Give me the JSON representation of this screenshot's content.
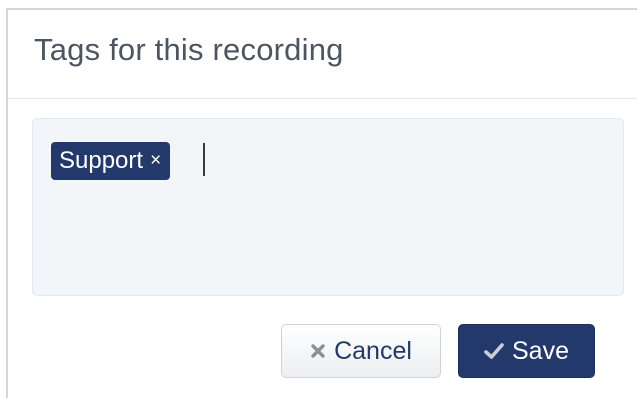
{
  "dialog": {
    "title": "Tags for this recording"
  },
  "tags": {
    "items": [
      {
        "label": "Support",
        "remove_glyph": "×"
      }
    ],
    "input_value": "",
    "input_placeholder": ""
  },
  "actions": {
    "cancel_label": "Cancel",
    "cancel_icon": "close-icon",
    "save_label": "Save",
    "save_icon": "check-icon"
  },
  "colors": {
    "brand": "#23396b",
    "title_text": "#4d5660",
    "field_background": "#f3f6f9"
  }
}
